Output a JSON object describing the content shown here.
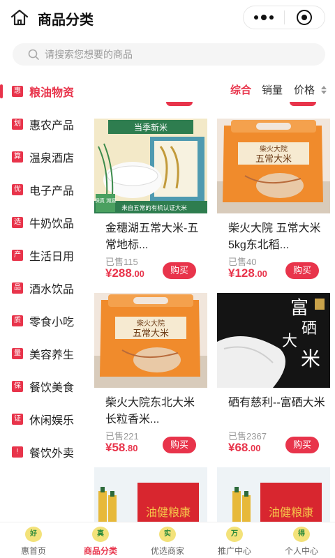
{
  "header": {
    "title": "商品分类"
  },
  "search": {
    "placeholder": "请搜索您想要的商品"
  },
  "sidebar": {
    "items": [
      {
        "badge": "惠",
        "label": "粮油物资",
        "active": true
      },
      {
        "badge": "划",
        "label": "惠农产品"
      },
      {
        "badge": "算",
        "label": "温泉酒店"
      },
      {
        "badge": "优",
        "label": "电子产品"
      },
      {
        "badge": "选",
        "label": "牛奶饮品"
      },
      {
        "badge": "产",
        "label": "生活日用"
      },
      {
        "badge": "品",
        "label": "酒水饮品"
      },
      {
        "badge": "质",
        "label": "零食小吃"
      },
      {
        "badge": "量",
        "label": "美容养生"
      },
      {
        "badge": "保",
        "label": "餐饮美食"
      },
      {
        "badge": "证",
        "label": "休闲娱乐"
      },
      {
        "badge": "!",
        "label": "餐饮外卖"
      }
    ]
  },
  "sort": {
    "comprehensive": "综合",
    "sales": "销量",
    "price": "价格"
  },
  "products": [
    {
      "name": "金穗湖五常大米-五常地标...",
      "sold": "已售115",
      "price_int": "¥288",
      "price_dec": ".00",
      "buy": "购买",
      "img_top": "当季新米",
      "img_bottom": "来自五常的有机认证大米",
      "img_tag": "保真 溯源"
    },
    {
      "name": "柴火大院 五常大米5kg东北稻...",
      "sold": "已售40",
      "price_int": "¥128",
      "price_dec": ".00",
      "buy": "购买",
      "img_brand": "柴火大院",
      "img_text": "五常大米"
    },
    {
      "name": "柴火大院东北大米长粒香米...",
      "sold": "已售221",
      "price_int": "¥58",
      "price_dec": ".80",
      "buy": "购买",
      "img_brand": "柴火大院",
      "img_text": "五常大米"
    },
    {
      "name": "硒有慈利--富硒大米",
      "sold": "已售2367",
      "price_int": "¥68",
      "price_dec": ".00",
      "buy": "购买",
      "img_text1": "富",
      "img_text2": "硒",
      "img_text3": "大",
      "img_text4": "米"
    },
    {
      "img_text": "油健粮康"
    },
    {
      "img_text": "油健粮康"
    }
  ],
  "tabs": [
    {
      "label": "惠首页",
      "icon": "好"
    },
    {
      "label": "商品分类",
      "icon": "真",
      "active": true
    },
    {
      "label": "优选商家",
      "icon": "实"
    },
    {
      "label": "推广中心",
      "icon": "万"
    },
    {
      "label": "个人中心",
      "icon": "得"
    }
  ],
  "colors": {
    "accent": "#e8344b"
  }
}
